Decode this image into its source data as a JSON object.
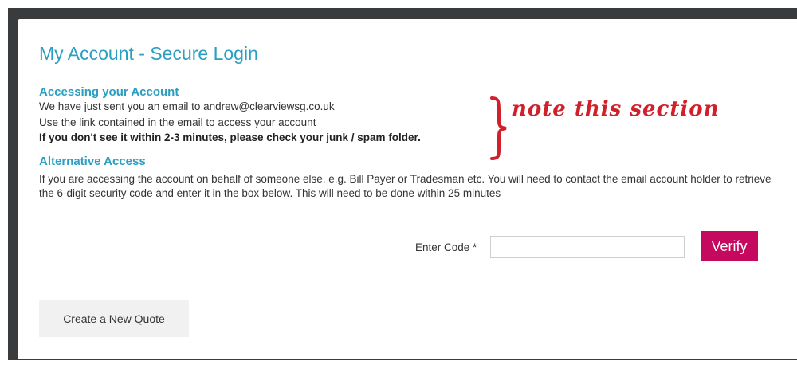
{
  "modal": {
    "title": "My Account - Secure Login"
  },
  "accessing": {
    "heading": "Accessing your Account",
    "line1": "We have just sent you an email to andrew@clearviewsg.co.uk",
    "line2": "Use the link contained in the email to access your account",
    "line3": "If you don't see it within 2-3 minutes, please check your junk / spam folder."
  },
  "alternative": {
    "heading": "Alternative Access",
    "paragraph": "If you are accessing the account on behalf of someone else, e.g. Bill Payer or Tradesman etc. You will need to contact the email account holder to retrieve the 6-digit security code and enter it in the box below. This will need to be done within 25 minutes"
  },
  "code_form": {
    "label": "Enter Code *",
    "value": "",
    "verify_label": "Verify"
  },
  "footer": {
    "create_quote_label": "Create a New Quote"
  },
  "annotation": {
    "text": "note this section"
  },
  "colors": {
    "accent": "#2a9fc2",
    "verify": "#c4095e",
    "annotation": "#d0202b"
  }
}
